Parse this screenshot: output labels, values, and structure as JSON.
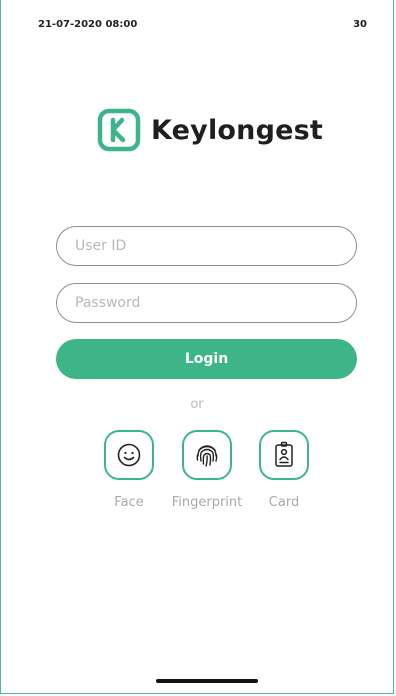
{
  "status_bar": {
    "datetime": "21-07-2020 08:00",
    "value": "30"
  },
  "brand": {
    "name": "Keylongest",
    "logo_icon": "keylongest-k-logo",
    "color": "#3db589"
  },
  "form": {
    "user_id_placeholder": "User ID",
    "user_id_value": "",
    "password_placeholder": "Password",
    "password_value": "",
    "login_label": "Login"
  },
  "separator": "or",
  "methods": [
    {
      "label": "Face",
      "icon": "face-smile-icon"
    },
    {
      "label": "Fingerprint",
      "icon": "fingerprint-icon"
    },
    {
      "label": "Card",
      "icon": "id-card-icon"
    }
  ],
  "colors": {
    "accent": "#3db589",
    "muted_text": "#a8a8a8",
    "border": "#8f8f8f"
  }
}
